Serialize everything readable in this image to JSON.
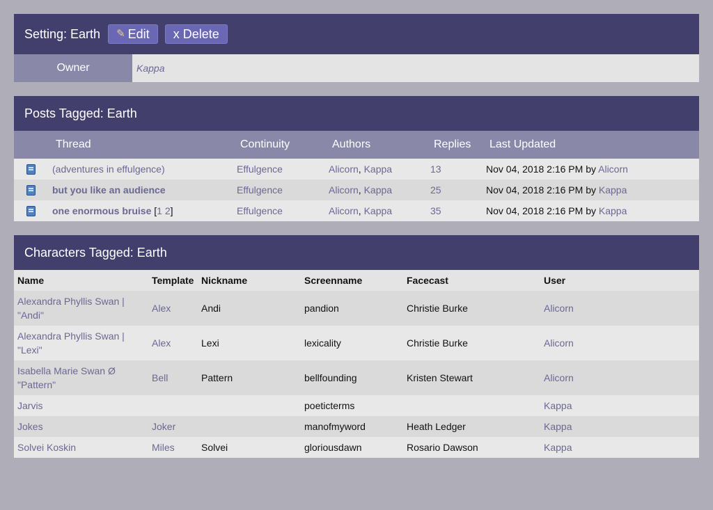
{
  "setting": {
    "title": "Setting: Earth",
    "edit_label": "Edit",
    "delete_label": "x Delete",
    "owner_label": "Owner",
    "owner_value": "Kappa"
  },
  "posts": {
    "title": "Posts Tagged: Earth",
    "headers": {
      "thread": "Thread",
      "continuity": "Continuity",
      "authors": "Authors",
      "replies": "Replies",
      "updated": "Last Updated"
    },
    "rows": [
      {
        "thread": "(adventures in effulgence)",
        "pages": "",
        "continuity": "Effulgence",
        "author1": "Alicorn",
        "author2": "Kappa",
        "replies": "13",
        "updated": "Nov 04, 2018 2:16 PM",
        "by": "by",
        "last_user": "Alicorn"
      },
      {
        "thread": "but you like an audience",
        "pages": "",
        "continuity": "Effulgence",
        "author1": "Alicorn",
        "author2": "Kappa",
        "replies": "25",
        "updated": "Nov 04, 2018 2:16 PM",
        "by": "by",
        "last_user": "Kappa"
      },
      {
        "thread": "one enormous bruise",
        "page1": "1",
        "page2": "2",
        "continuity": "Effulgence",
        "author1": "Alicorn",
        "author2": "Kappa",
        "replies": "35",
        "updated": "Nov 04, 2018 2:16 PM",
        "by": "by",
        "last_user": "Kappa"
      }
    ]
  },
  "characters": {
    "title": "Characters Tagged: Earth",
    "headers": {
      "name": "Name",
      "template": "Template",
      "nickname": "Nickname",
      "screenname": "Screenname",
      "facecast": "Facecast",
      "user": "User"
    },
    "rows": [
      {
        "name_line1": "Alexandra Phyllis Swan |",
        "name_line2": "\"Andi\"",
        "template": "Alex",
        "nickname": "Andi",
        "screenname": "pandion",
        "facecast": "Christie Burke",
        "user": "Alicorn"
      },
      {
        "name_line1": "Alexandra Phyllis Swan |",
        "name_line2": "\"Lexi\"",
        "template": "Alex",
        "nickname": "Lexi",
        "screenname": "lexicality",
        "facecast": "Christie Burke",
        "user": "Alicorn"
      },
      {
        "name_line1": "Isabella Marie Swan Ø",
        "name_line2": "\"Pattern\"",
        "template": "Bell",
        "nickname": "Pattern",
        "screenname": "bellfounding",
        "facecast": "Kristen Stewart",
        "user": "Alicorn"
      },
      {
        "name_line1": "Jarvis",
        "name_line2": "",
        "template": "",
        "nickname": "",
        "screenname": "poeticterms",
        "facecast": "",
        "user": "Kappa"
      },
      {
        "name_line1": "Jokes",
        "name_line2": "",
        "template": "Joker",
        "nickname": "",
        "screenname": "manofmyword",
        "facecast": "Heath Ledger",
        "user": "Kappa"
      },
      {
        "name_line1": "Solvei Koskin",
        "name_line2": "",
        "template": "Miles",
        "nickname": "Solvei",
        "screenname": "gloriousdawn",
        "facecast": "Rosario Dawson",
        "user": "Kappa"
      }
    ]
  },
  "colors": {
    "header_bg": "#433f6c",
    "subheader_bg": "#8a88a8",
    "button_bg": "#6a67b4",
    "link": "#6a6894",
    "page_bg": "#afadb8"
  },
  "icons": {
    "edit": "pencil-icon",
    "thread": "book-icon"
  }
}
